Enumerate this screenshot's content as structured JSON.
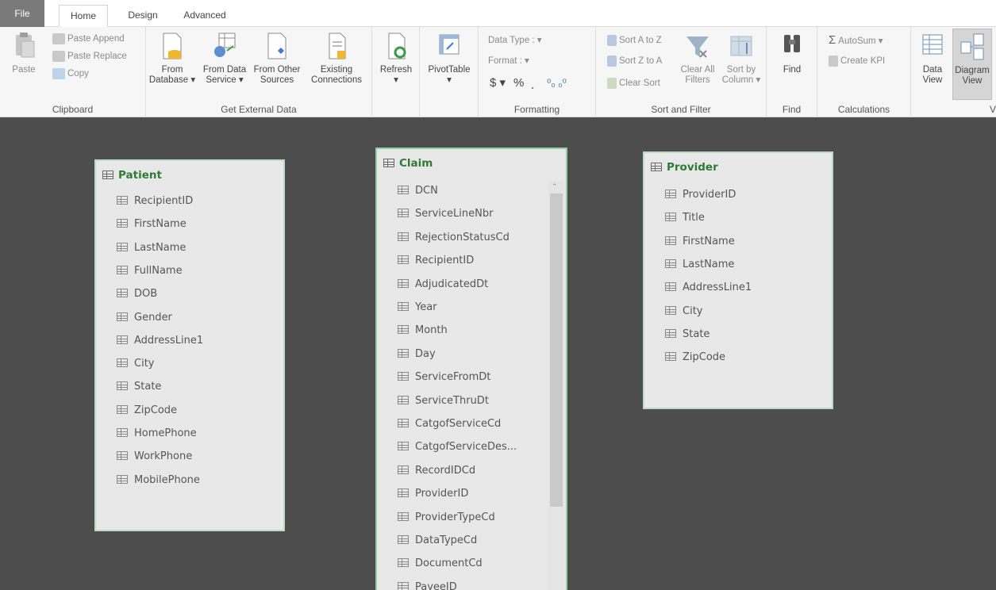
{
  "tabs": {
    "file": "File",
    "home": "Home",
    "design": "Design",
    "advanced": "Advanced"
  },
  "ribbon": {
    "clipboard": {
      "paste": "Paste",
      "paste_append": "Paste Append",
      "paste_replace": "Paste Replace",
      "copy": "Copy",
      "label": "Clipboard"
    },
    "external": {
      "from_database": [
        "From",
        "Database ▾"
      ],
      "from_data_service": [
        "From Data",
        "Service ▾"
      ],
      "from_other_sources": [
        "From Other",
        "Sources"
      ],
      "existing_connections": [
        "Existing",
        "Connections"
      ],
      "label": "Get External Data"
    },
    "refresh": {
      "label": "Refresh",
      "arrow": "▾"
    },
    "pivot": {
      "label": "PivotTable",
      "arrow": "▾"
    },
    "formatting": {
      "data_type": "Data Type : ▾",
      "format": "Format : ▾",
      "currency": "$ ▾",
      "percent": "%",
      "comma": "͵",
      "inc_dec": "⁰₀ ₀⁰",
      "label": "Formatting"
    },
    "sort_filter": {
      "sort_az": "Sort A to Z",
      "sort_za": "Sort Z to A",
      "clear_sort": "Clear Sort",
      "clear_filters": [
        "Clear All",
        "Filters"
      ],
      "sort_by_column": [
        "Sort by",
        "Column ▾"
      ],
      "label": "Sort and Filter"
    },
    "find": {
      "button": "Find",
      "label": "Find"
    },
    "calculations": {
      "autosum": "AutoSum ▾",
      "create_kpi": "Create KPI",
      "label": "Calculations"
    },
    "view": {
      "data_view": [
        "Data",
        "View"
      ],
      "diagram_view": [
        "Diagram",
        "View"
      ],
      "label": "V"
    }
  },
  "tables": {
    "patient": {
      "name": "Patient",
      "columns": [
        "RecipientID",
        "FirstName",
        "LastName",
        "FullName",
        "DOB",
        "Gender",
        "AddressLine1",
        "City",
        "State",
        "ZipCode",
        "HomePhone",
        "WorkPhone",
        "MobilePhone"
      ]
    },
    "claim": {
      "name": "Claim",
      "columns": [
        "DCN",
        "ServiceLineNbr",
        "RejectionStatusCd",
        "RecipientID",
        "AdjudicatedDt",
        "Year",
        "Month",
        "Day",
        "ServiceFromDt",
        "ServiceThruDt",
        "CatgofServiceCd",
        "CatgofServiceDes...",
        "RecordIDCd",
        "ProviderID",
        "ProviderTypeCd",
        "DataTypeCd",
        "DocumentCd",
        "PayeeID"
      ]
    },
    "provider": {
      "name": "Provider",
      "columns": [
        "ProviderID",
        "Title",
        "FirstName",
        "LastName",
        "AddressLine1",
        "City",
        "State",
        "ZipCode"
      ]
    }
  },
  "colors": {
    "canvas": "#4d4d4d",
    "table_title": "#2f7a36",
    "table_border": "#b9dcc3",
    "file_tab": "#7a7a7a"
  }
}
